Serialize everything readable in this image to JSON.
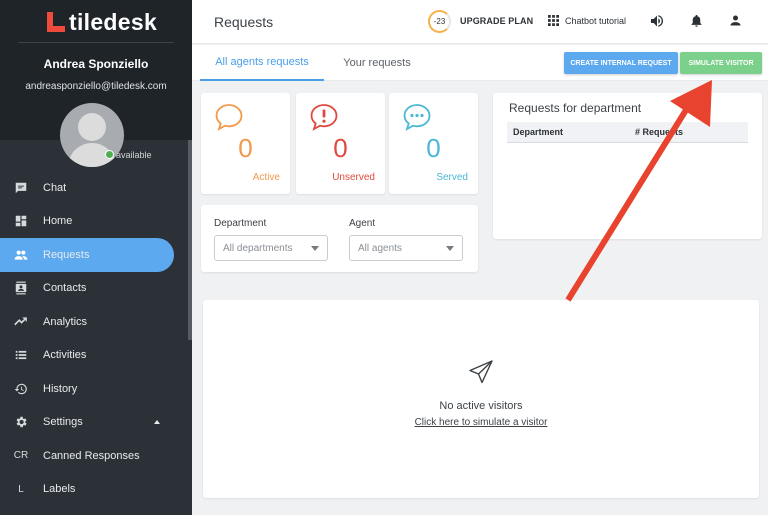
{
  "app": {
    "logo_text": "tiledesk"
  },
  "user": {
    "name": "Andrea Sponziello",
    "email": "andreasponziello@tiledesk.com",
    "status": "available"
  },
  "sidebar": {
    "items": [
      {
        "label": "Chat",
        "icon": "chat-icon"
      },
      {
        "label": "Home",
        "icon": "dashboard-icon"
      },
      {
        "label": "Requests",
        "icon": "people-icon",
        "active": true
      },
      {
        "label": "Contacts",
        "icon": "contacts-icon"
      },
      {
        "label": "Analytics",
        "icon": "trending-icon"
      },
      {
        "label": "Activities",
        "icon": "list-icon"
      },
      {
        "label": "History",
        "icon": "history-icon"
      },
      {
        "label": "Settings",
        "icon": "gear-icon"
      },
      {
        "label": "Canned Responses",
        "icon_text": "CR"
      },
      {
        "label": "Labels",
        "icon_text": "L"
      }
    ]
  },
  "header": {
    "title": "Requests",
    "plan_badge": "-23",
    "plan_label": "UPGRADE PLAN",
    "chatbot_label": "Chatbot tutorial"
  },
  "tabs": {
    "all": "All agents requests",
    "yours": "Your requests"
  },
  "actions": {
    "internal": "CREATE INTERNAL REQUEST",
    "simulate": "SIMULATE VISITOR"
  },
  "stats": {
    "active": {
      "value": "0",
      "label": "Active",
      "color": "#f2994a"
    },
    "unserved": {
      "value": "0",
      "label": "Unserved",
      "color": "#e0493f"
    },
    "served": {
      "value": "0",
      "label": "Served",
      "color": "#4ab8d3"
    }
  },
  "filters": {
    "department_label": "Department",
    "department_value": "All departments",
    "agent_label": "Agent",
    "agent_value": "All agents"
  },
  "department_panel": {
    "title": "Requests for department",
    "col_department": "Department",
    "col_requests": "# Requests"
  },
  "empty_state": {
    "title": "No active visitors",
    "link": "Click here to simulate a visitor"
  },
  "colors": {
    "accent": "#5da9f0",
    "success": "#7bd18c",
    "sidebar": "#2b3137",
    "annotation": "#e8432e"
  }
}
